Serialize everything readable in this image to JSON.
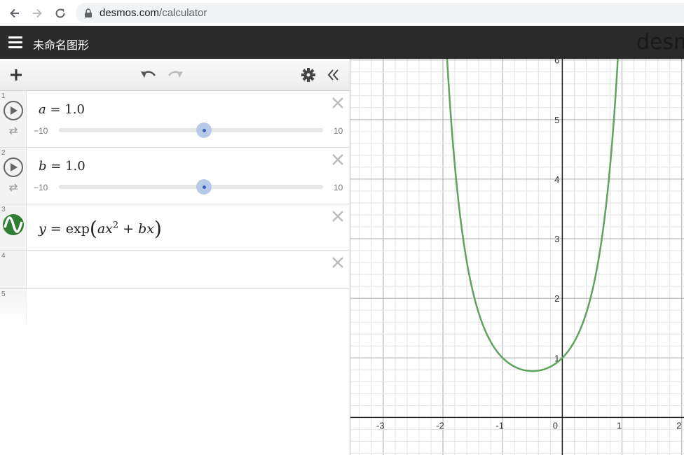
{
  "browser": {
    "url_domain": "desmos.com",
    "url_path": "/calculator"
  },
  "app": {
    "graph_title": "未命名图形",
    "brand": "desm"
  },
  "expressions": [
    {
      "index": "1",
      "latex_left": "a",
      "latex_op": "=",
      "value": "1.0",
      "slider_min": "−10",
      "slider_max": "10"
    },
    {
      "index": "2",
      "latex_left": "b",
      "latex_op": "=",
      "value": "1.0",
      "slider_min": "−10",
      "slider_max": "10"
    },
    {
      "index": "3",
      "formula": {
        "y": "y",
        "eq": "=",
        "fn": "exp",
        "a": "a",
        "x1": "x",
        "pow": "2",
        "plus": "+",
        "b": "b",
        "x2": "x"
      }
    },
    {
      "index": "4"
    },
    {
      "index": "5"
    }
  ],
  "graph": {
    "curve_color": "#5fa35f",
    "x_ticks": [
      "-3",
      "-2",
      "-1",
      "0",
      "1",
      "2"
    ],
    "y_ticks": [
      "1",
      "2",
      "3",
      "4",
      "5",
      "6"
    ],
    "x_range": [
      -3.55,
      2.05
    ],
    "y_range": [
      -0.63,
      6.02
    ],
    "function": "exp(a*x^2 + b*x)",
    "a": 1.0,
    "b": 1.0
  }
}
